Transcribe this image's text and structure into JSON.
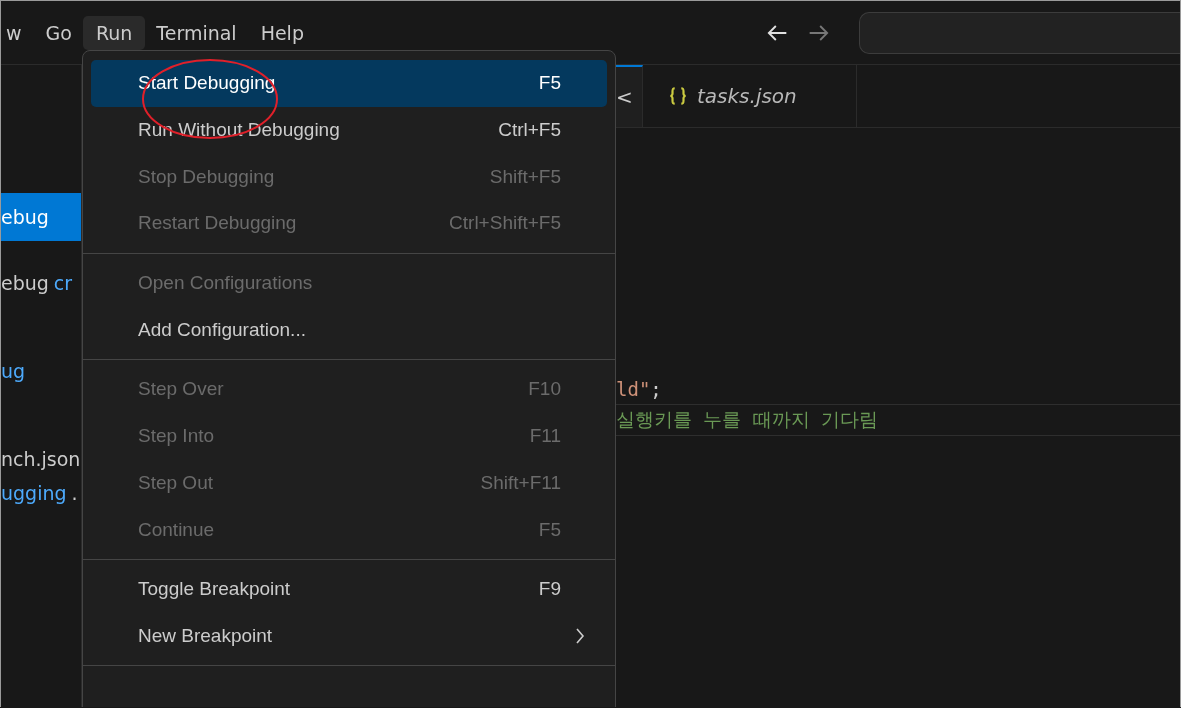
{
  "menu_bar": [
    {
      "label": "w",
      "selected": false
    },
    {
      "label": "Go",
      "selected": false
    },
    {
      "label": "Run",
      "selected": true
    },
    {
      "label": "Terminal",
      "selected": false
    },
    {
      "label": "Help",
      "selected": false
    }
  ],
  "navigation": [
    {
      "kind": "back",
      "disabled": false
    },
    {
      "kind": "forward",
      "disabled": true
    }
  ],
  "sidebar": {
    "lines": [
      {
        "selected": true,
        "segments": [
          {
            "text": "ebug",
            "kind": "plain"
          }
        ]
      },
      {
        "selected": false,
        "segments": [
          {
            "text": "ebug",
            "kind": "plain"
          },
          {
            "text": "cr",
            "kind": "link"
          }
        ]
      },
      {
        "selected": false,
        "segments": [
          {
            "text": "ug",
            "kind": "link"
          }
        ]
      },
      {
        "selected": false,
        "segments": [
          {
            "text": "nch.json",
            "kind": "plain"
          }
        ]
      },
      {
        "selected": false,
        "segments": [
          {
            "text": "ugging",
            "kind": "link"
          },
          {
            "text": ".",
            "kind": "plain"
          }
        ]
      }
    ]
  },
  "tabs": [
    {
      "label": "<",
      "kind": "partial",
      "selected": true
    },
    {
      "label": "tasks.json",
      "kind": "json",
      "selected": false
    }
  ],
  "code": [
    {
      "current": false,
      "tokens": [
        {
          "text": "ld\"",
          "kind": "string"
        },
        {
          "text": ";",
          "kind": "punct"
        }
      ]
    },
    {
      "current": true,
      "tokens": [
        {
          "text": "실행키를 누를 때까지 기다림",
          "kind": "comment"
        }
      ]
    }
  ],
  "run_menu": [
    {
      "kind": "item",
      "label": "Start Debugging",
      "shortcut": "F5",
      "disabled": false,
      "selected": true
    },
    {
      "kind": "item",
      "label": "Run Without Debugging",
      "shortcut": "Ctrl+F5",
      "disabled": false,
      "selected": false
    },
    {
      "kind": "item",
      "label": "Stop Debugging",
      "shortcut": "Shift+F5",
      "disabled": true,
      "selected": false
    },
    {
      "kind": "item",
      "label": "Restart Debugging",
      "shortcut": "Ctrl+Shift+F5",
      "disabled": true,
      "selected": false
    },
    {
      "kind": "separator"
    },
    {
      "kind": "item",
      "label": "Open Configurations",
      "disabled": true,
      "selected": false
    },
    {
      "kind": "item",
      "label": "Add Configuration...",
      "disabled": false,
      "selected": false
    },
    {
      "kind": "separator"
    },
    {
      "kind": "item",
      "label": "Step Over",
      "shortcut": "F10",
      "disabled": true,
      "selected": false
    },
    {
      "kind": "item",
      "label": "Step Into",
      "shortcut": "F11",
      "disabled": true,
      "selected": false
    },
    {
      "kind": "item",
      "label": "Step Out",
      "shortcut": "Shift+F11",
      "disabled": true,
      "selected": false
    },
    {
      "kind": "item",
      "label": "Continue",
      "shortcut": "F5",
      "disabled": true,
      "selected": false
    },
    {
      "kind": "separator"
    },
    {
      "kind": "item",
      "label": "Toggle Breakpoint",
      "shortcut": "F9",
      "disabled": false,
      "selected": false
    },
    {
      "kind": "submenu",
      "label": "New Breakpoint",
      "disabled": false,
      "selected": false
    },
    {
      "kind": "separator"
    }
  ],
  "annotation": {
    "kind": "ellipse",
    "color": "#e0202a"
  }
}
